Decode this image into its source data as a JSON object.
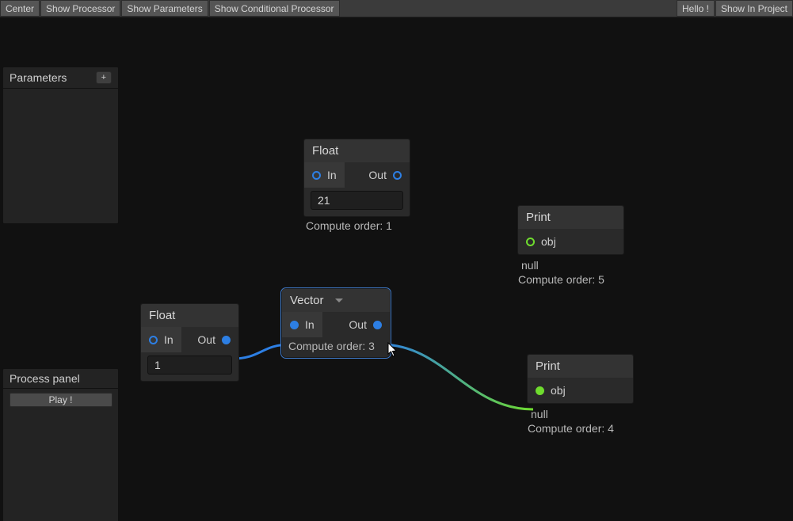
{
  "toolbar": {
    "left": [
      "Center",
      "Show Processor",
      "Show Parameters",
      "Show Conditional Processor"
    ],
    "right": [
      "Hello !",
      "Show In Project"
    ]
  },
  "panels": {
    "parameters": {
      "title": "Parameters",
      "add_label": "+"
    },
    "process": {
      "title": "Process panel",
      "play_label": "Play !"
    }
  },
  "nodes": {
    "float1": {
      "title": "Float",
      "in_label": "In",
      "out_label": "Out",
      "value": "21",
      "footer": "Compute order: 1"
    },
    "float2": {
      "title": "Float",
      "in_label": "In",
      "out_label": "Out",
      "value": "1",
      "footer": ""
    },
    "vector": {
      "title": "Vector",
      "in_label": "In",
      "out_label": "Out",
      "footer": "Compute order: 3"
    },
    "print1": {
      "title": "Print",
      "obj_label": "obj",
      "null_label": "null",
      "footer": "Compute order: 5"
    },
    "print2": {
      "title": "Print",
      "obj_label": "obj",
      "null_label": "null",
      "footer": "Compute order: 4"
    }
  }
}
